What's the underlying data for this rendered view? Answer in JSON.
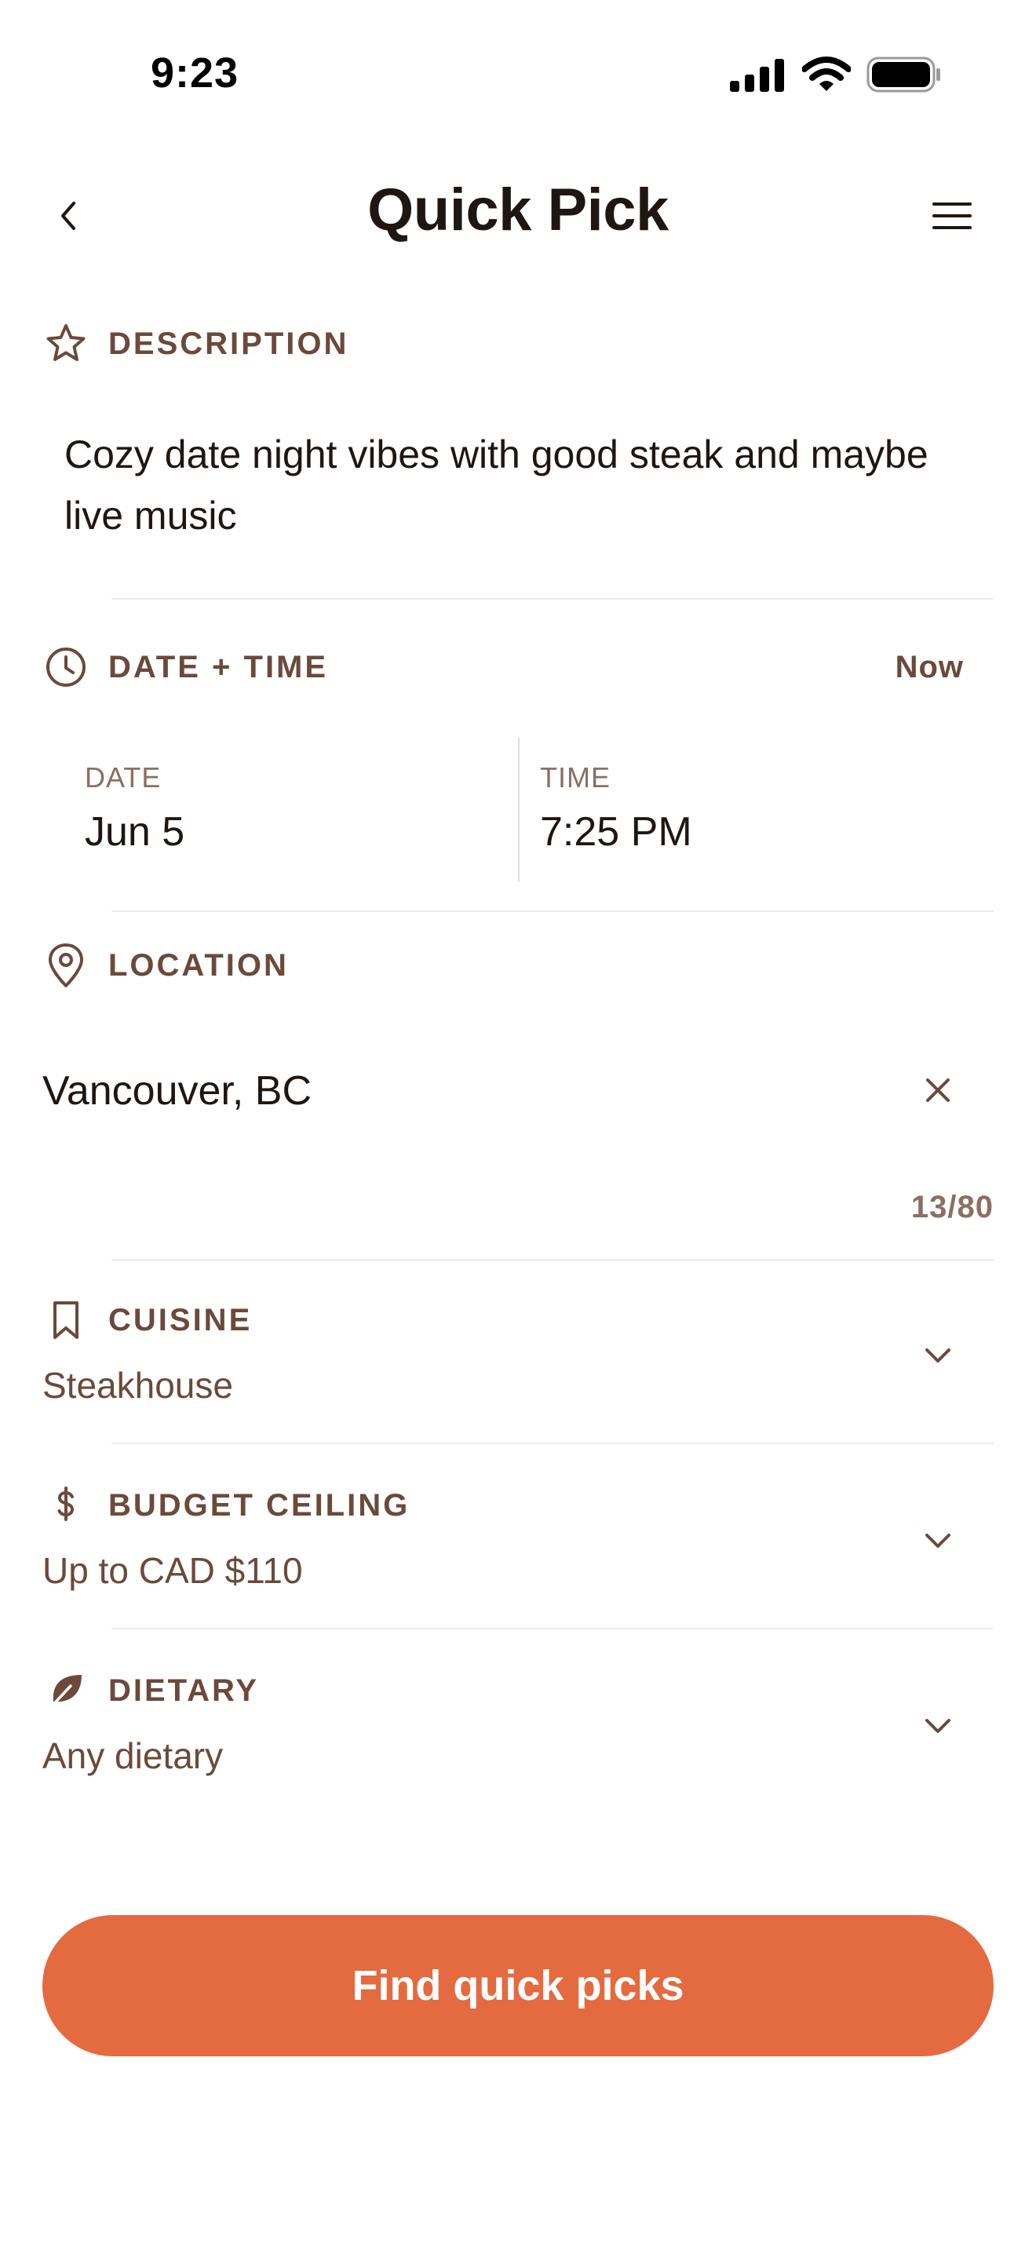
{
  "status_bar": {
    "time": "9:23"
  },
  "header": {
    "title": "Quick Pick"
  },
  "description": {
    "label": "DESCRIPTION",
    "text": "Cozy date night vibes with good steak and maybe live music"
  },
  "datetime": {
    "label": "DATE + TIME",
    "now_label": "Now",
    "date_label": "DATE",
    "date_value": "Jun 5",
    "time_label": "TIME",
    "time_value": "7:25 PM"
  },
  "location": {
    "label": "LOCATION",
    "value": "Vancouver, BC",
    "char_count": "13/80"
  },
  "cuisine": {
    "label": "CUISINE",
    "value": "Steakhouse"
  },
  "budget": {
    "label": "BUDGET CEILING",
    "value": "Up to CAD $110"
  },
  "dietary": {
    "label": "DIETARY",
    "value": "Any dietary"
  },
  "cta": {
    "label": "Find quick picks"
  },
  "colors": {
    "accent": "#e46a3f",
    "label_brown": "#6b4a3a",
    "text_dark": "#1f1612",
    "muted": "#8a6f62",
    "divider": "#efebe8"
  },
  "icons": {
    "description": "star-icon",
    "datetime": "clock-icon",
    "location": "map-pin-icon",
    "cuisine": "bookmark-icon",
    "budget": "dollar-icon",
    "dietary": "leaf-icon"
  }
}
